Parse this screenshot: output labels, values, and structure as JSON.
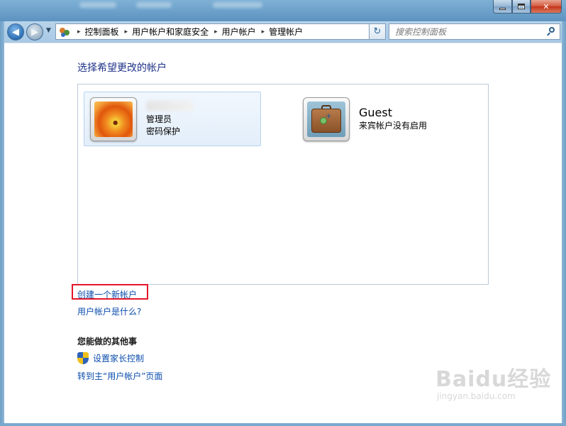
{
  "window": {
    "controls": {
      "minimize": "minimize",
      "maximize": "maximize",
      "close": "✕"
    }
  },
  "nav": {
    "back": "◀",
    "forward": "▶",
    "dropdown": "▼",
    "refresh": "↻"
  },
  "breadcrumb": {
    "items": [
      "控制面板",
      "用户帐户和家庭安全",
      "用户帐户",
      "管理帐户"
    ],
    "separator": "▸"
  },
  "search": {
    "placeholder": "搜索控制面板"
  },
  "main": {
    "heading": "选择希望更改的帐户",
    "accounts": [
      {
        "role": "管理员",
        "status": "密码保护",
        "avatar": "flower-avatar"
      },
      {
        "name": "Guest",
        "status": "来宾帐户没有启用",
        "avatar": "suitcase-avatar"
      }
    ],
    "create_link": "创建一个新帐户",
    "whatis_link": "用户帐户是什么?",
    "other_heading": "您能做的其他事",
    "tasks": {
      "parental": "设置家长控制",
      "goto_main": "转到主“用户帐户”页面"
    }
  },
  "watermark": {
    "logo": "Baidu经验",
    "url": "jingyan.baidu.com"
  },
  "colors": {
    "link": "#0b4dac",
    "heading": "#1e3287",
    "highlight": "#e4162b"
  }
}
